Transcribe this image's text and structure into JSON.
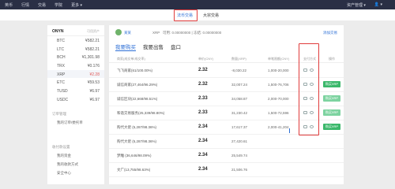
{
  "topnav": {
    "items": [
      "英币",
      "行情",
      "交易",
      "学院",
      "更多 ▾"
    ],
    "right_items": [
      "资产管理 ▾",
      "👤 ▾"
    ]
  },
  "subtabs": {
    "active": "法币交易",
    "other": "大宗交易"
  },
  "sidebar": {
    "title": "ONYN",
    "hint": "可用资产",
    "coins": [
      {
        "name": "BTC",
        "value": "¥582.21"
      },
      {
        "name": "LTC",
        "value": "¥582.21"
      },
      {
        "name": "BCH",
        "value": "¥1,301.98"
      },
      {
        "name": "TRX",
        "value": "¥0.176"
      },
      {
        "name": "XRP",
        "value": "¥2.28"
      },
      {
        "name": "ETC",
        "value": "¥59.53"
      },
      {
        "name": "TUSD",
        "value": "¥6.97"
      },
      {
        "name": "USDC",
        "value": "¥6.97"
      }
    ],
    "sections": [
      {
        "title": "订单管理",
        "items": [
          "我的订单/委托单"
        ]
      },
      {
        "title": "收付款设置",
        "items": [
          "我的资金",
          "我的收款方式",
          "安全中心"
        ]
      }
    ]
  },
  "main": {
    "user": {
      "name": "某某",
      "balance_label": "XRP",
      "balance": "可用: 0.00000000 | 冻结: 0.00000000",
      "link": "添加交易"
    },
    "tabs": [
      "我要购买",
      "我要出售",
      "盘口"
    ],
    "headers": [
      "商家(成交单/成交率)",
      "单价(CNY)",
      "数量(XRP)",
      "单笔限额(CNY)",
      "支付方式",
      "操作"
    ],
    "rows": [
      {
        "user": "飞飞商家(61/100.00%)",
        "price": "2.32",
        "qty": "-8,030.22",
        "limit": "1,000-20,000",
        "pay": "",
        "btn": ""
      },
      {
        "user": "诚信商家(27,464/96.29%)",
        "price": "2.32",
        "qty": "32,007.24",
        "limit": "1,500-76,706",
        "pay": "icons",
        "btn": "购买XRP"
      },
      {
        "user": "诚信区块(22,668/98.51%)",
        "price": "2.33",
        "qty": "34,058.87",
        "limit": "2,000-70,000",
        "pay": "icons",
        "btn": "购买XRP"
      },
      {
        "user": "和谐交易服务(25,339/98.80%)",
        "price": "2.33",
        "qty": "31,230.42",
        "limit": "1,500-72,596",
        "pay": "icons",
        "btn": "购买XRP"
      },
      {
        "user": "购代大佬 (5,287/98.36%)",
        "price": "2.34",
        "qty": "17,617.37",
        "limit": "2,000-41,204",
        "pay": "icons",
        "btn": "购买XRP"
      },
      {
        "user": "购代大佬 (5,287/98.36%)",
        "price": "2.34",
        "qty": "27,420.61",
        "limit": "",
        "pay": "",
        "btn": ""
      },
      {
        "user": "梦雕 (36,646/98.09%)",
        "price": "2.34",
        "qty": "25,549.74",
        "limit": "",
        "pay": "",
        "btn": ""
      },
      {
        "user": "文广(13,755/98.63%)",
        "price": "2.34",
        "qty": "21,506.76",
        "limit": "",
        "pay": "",
        "btn": ""
      }
    ]
  }
}
